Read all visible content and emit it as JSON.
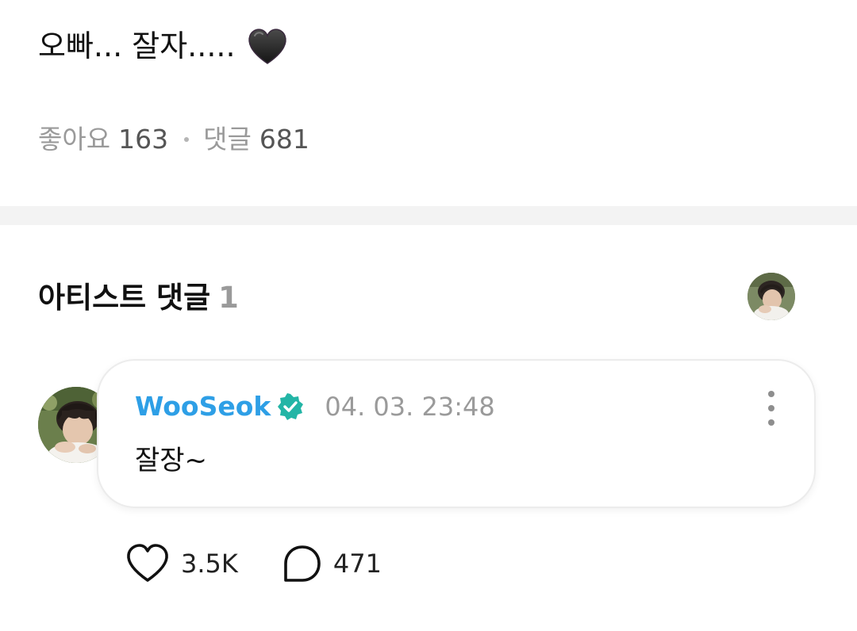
{
  "post": {
    "text": "오빠... 잘자.....",
    "emoji_icon": "black-heart-icon",
    "likes_label": "좋아요",
    "likes_count": "163",
    "comments_label": "댓글",
    "comments_count": "681"
  },
  "artist_comments": {
    "title": "아티스트 댓글",
    "count": "1"
  },
  "comment": {
    "author": "WooSeok",
    "verified_icon": "verified-badge-icon",
    "timestamp": "04. 03. 23:48",
    "body": "잘장~",
    "more_icon": "more-vertical-icon",
    "like_icon": "heart-outline-icon",
    "like_count": "3.5K",
    "reply_icon": "speech-bubble-icon",
    "reply_count": "471"
  },
  "colors": {
    "author_name": "#2e9fe6",
    "verified_badge": "#23b5a6",
    "muted_text": "#9a9a9a",
    "divider": "#f3f3f3"
  }
}
